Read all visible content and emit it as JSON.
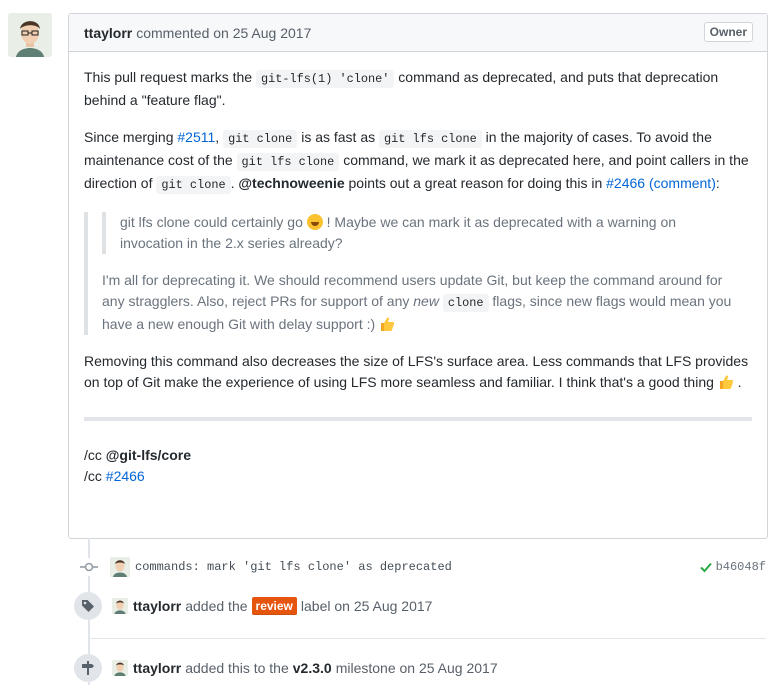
{
  "comment": {
    "author": "ttaylorr",
    "action": "commented on 25 Aug 2017",
    "badge": "Owner",
    "p1": {
      "t1": "This pull request marks the ",
      "code1": "git-lfs(1) 'clone'",
      "t2": " command as deprecated, and puts that deprecation behind a \"feature flag\"."
    },
    "p2": {
      "t1": "Since merging ",
      "link1": "#2511",
      "t2": ", ",
      "code1": "git clone",
      "t3": " is as fast as ",
      "code2": "git lfs clone",
      "t4": " in the majority of cases. To avoid the maintenance cost of the ",
      "code3": "git lfs clone",
      "t5": " command, we mark it as deprecated here, and point callers in the direction of ",
      "code4": "git clone",
      "t6": ". ",
      "mention": "@technoweenie",
      "t7": " points out a great reason for doing this in ",
      "link2": "#2466",
      "link3": "(comment)",
      "t8": ":"
    },
    "quote": {
      "nested_t1": "git lfs clone could certainly go ",
      "nested_t2": " ! Maybe we can mark it as deprecated with a warning on invocation in the 2.x series already?",
      "t1": "I'm all for deprecating it. We should recommend users update Git, but keep the command around for any stragglers. Also, reject PRs for support of any ",
      "em": "new",
      "t2": " ",
      "code": "clone",
      "t3": " flags, since new flags would mean you have a new enough Git with delay support :) "
    },
    "p3": {
      "t1": "Removing this command also decreases the size of LFS's surface area. Less commands that LFS provides on top of Git make the experience of using LFS more seamless and familiar. I think that's a good thing ",
      "t2": " ."
    },
    "cc1": {
      "prefix": "/cc ",
      "team": "@git-lfs/core"
    },
    "cc2": {
      "prefix": "/cc ",
      "link": "#2466"
    }
  },
  "timeline": {
    "commit": {
      "message": "commands: mark 'git lfs clone' as deprecated",
      "sha": "b46048f"
    },
    "label_event": {
      "author": "ttaylorr",
      "t1": "added the",
      "label": "review",
      "t2": "label on 25 Aug 2017"
    },
    "milestone_event": {
      "author": "ttaylorr",
      "t1": "added this to the",
      "milestone": "v2.3.0",
      "t2": "milestone on 25 Aug 2017"
    }
  },
  "icons": [
    "avatar",
    "emoji-grinning",
    "emoji-thumbsup",
    "commit-icon",
    "check-icon",
    "tag-icon",
    "milestone-icon"
  ],
  "colors": {
    "link": "#0366d6",
    "label_review": "#e6550d",
    "check": "#28a745"
  }
}
